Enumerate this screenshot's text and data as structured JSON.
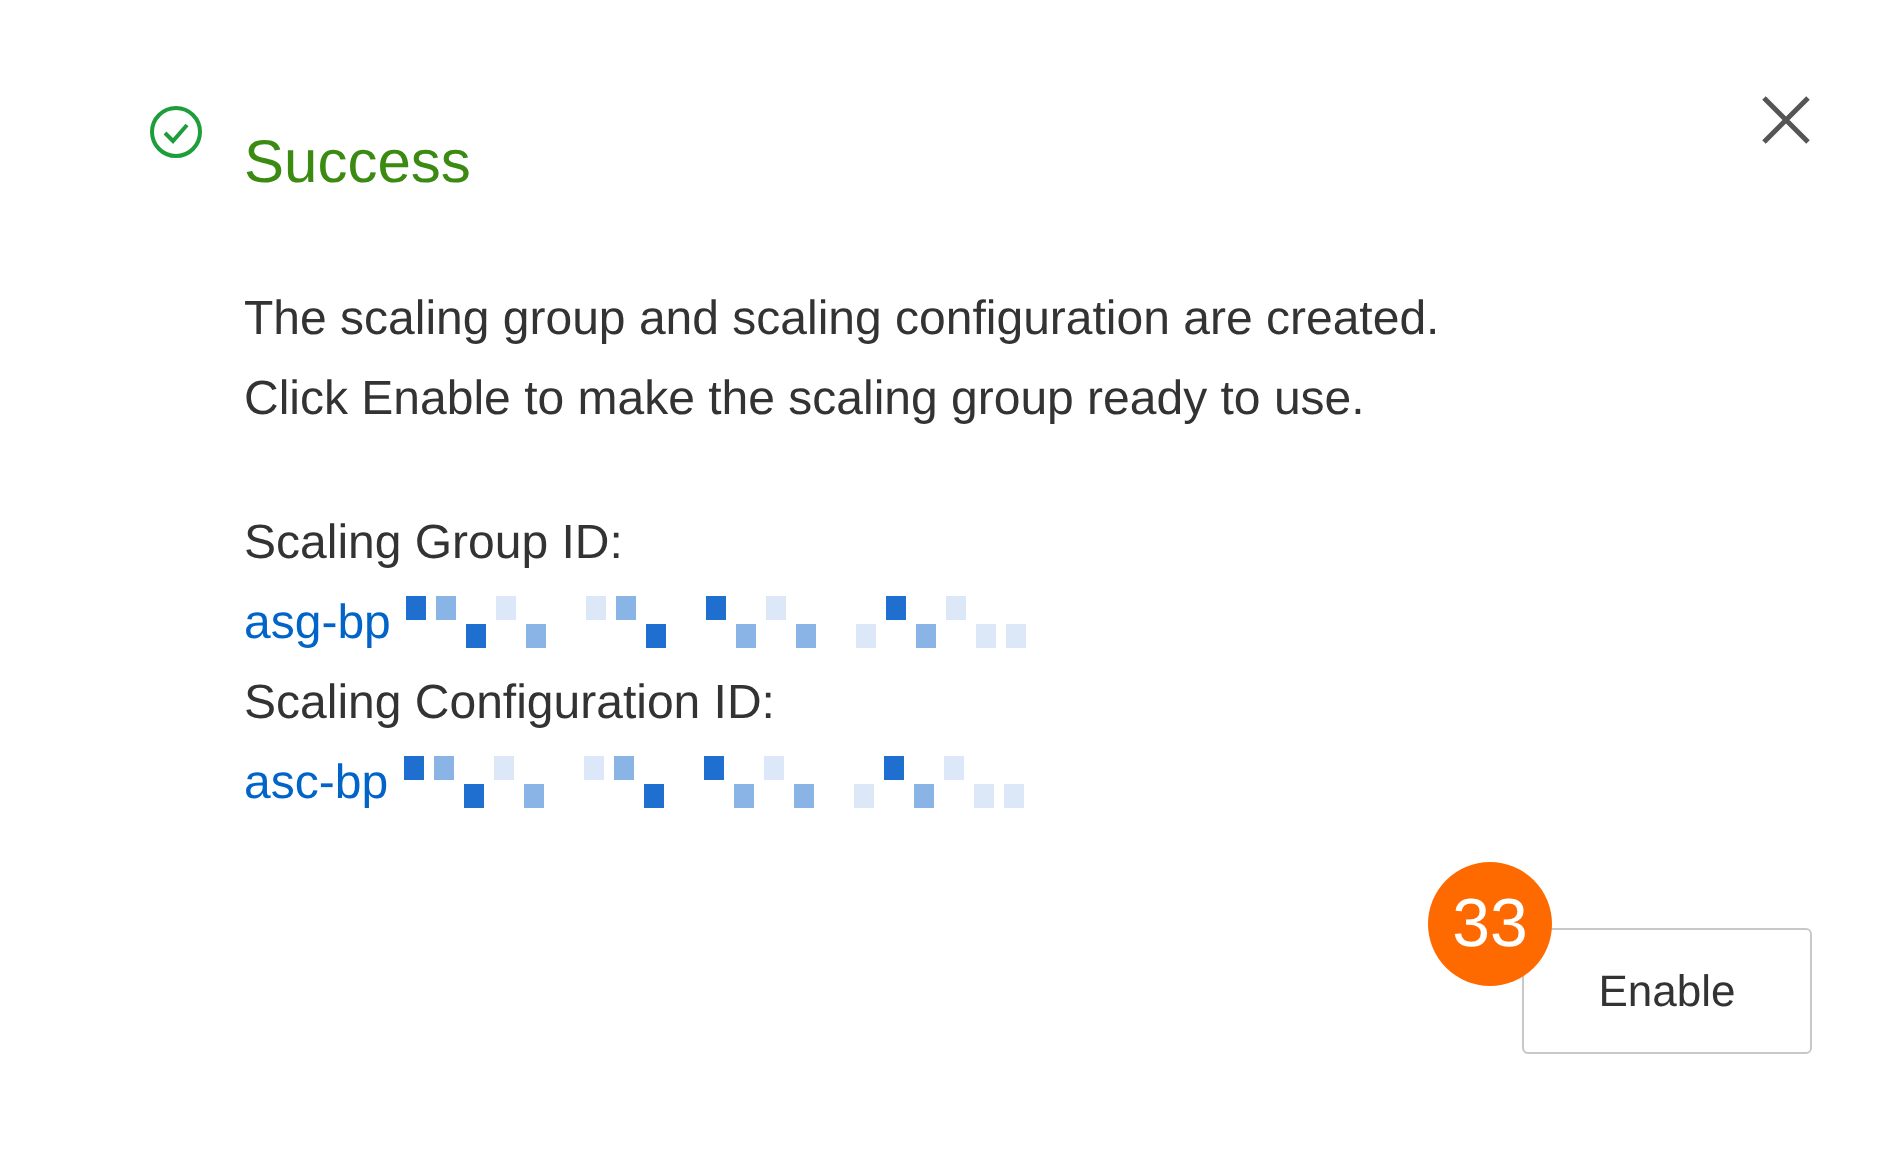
{
  "dialog": {
    "title": "Success",
    "message_lines": [
      "The scaling group and scaling configuration are created.",
      "Click Enable to make the scaling group ready to use."
    ],
    "fields": [
      {
        "label": "Scaling Group ID:",
        "value": "asg-bp"
      },
      {
        "label": "Scaling Configuration ID:",
        "value": "asc-bp"
      }
    ],
    "callout": {
      "number": "33"
    },
    "buttons": [
      "Enable"
    ]
  }
}
